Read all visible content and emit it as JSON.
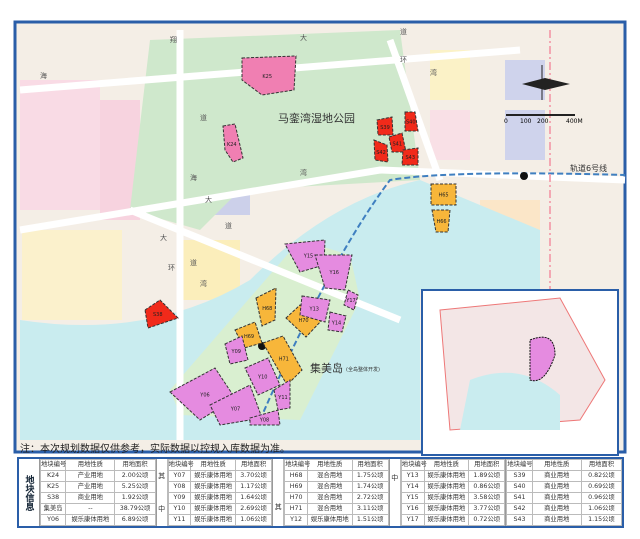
{
  "map": {
    "park_label": "马銮湾湿地公园",
    "island_label": "集美岛",
    "island_sublabel": "(全岛整体开发)",
    "metro_label": "轨道6号线",
    "road_chars": [
      "海",
      "翔",
      "大",
      "道",
      "环",
      "湾",
      "道",
      "海",
      "湾",
      "大",
      "道",
      "大",
      "道",
      "环",
      "湾"
    ],
    "scale": {
      "ticks": [
        "0",
        "100",
        "200",
        "400M"
      ]
    },
    "compass_icon": "north-arrow",
    "colors": {
      "park": "#cfe8cc",
      "water": "#c9ecef",
      "entertainment": "#e58be0",
      "mixed": "#f7b63a",
      "commercial": "#f12a1a",
      "industrial": "#f07fb2",
      "border": "#2a5ea8",
      "metro": "#3f7fc0"
    },
    "parcels": [
      {
        "id": "K25",
        "type": "industrial"
      },
      {
        "id": "K24",
        "type": "industrial"
      },
      {
        "id": "S38",
        "type": "commercial"
      },
      {
        "id": "S39",
        "type": "commercial"
      },
      {
        "id": "S40",
        "type": "commercial"
      },
      {
        "id": "S41",
        "type": "commercial"
      },
      {
        "id": "S42",
        "type": "commercial"
      },
      {
        "id": "S43",
        "type": "commercial"
      },
      {
        "id": "H65",
        "type": "mixed"
      },
      {
        "id": "H66",
        "type": "mixed"
      },
      {
        "id": "H68",
        "type": "mixed"
      },
      {
        "id": "H69",
        "type": "mixed"
      },
      {
        "id": "H70",
        "type": "mixed"
      },
      {
        "id": "H71",
        "type": "mixed"
      },
      {
        "id": "Y15",
        "type": "entertainment"
      },
      {
        "id": "Y16",
        "type": "entertainment"
      },
      {
        "id": "Y17",
        "type": "entertainment"
      },
      {
        "id": "Y13",
        "type": "entertainment"
      },
      {
        "id": "Y14",
        "type": "entertainment"
      },
      {
        "id": "Y09",
        "type": "entertainment"
      },
      {
        "id": "Y06",
        "type": "entertainment"
      },
      {
        "id": "Y10",
        "type": "entertainment"
      },
      {
        "id": "Y07",
        "type": "entertainment"
      },
      {
        "id": "Y11",
        "type": "entertainment"
      },
      {
        "id": "Y08",
        "type": "entertainment"
      }
    ]
  },
  "note": "注：本次规划数据仅供参考，实际数据以控规入库数据为准。",
  "table": {
    "side_label": "地块信息",
    "headers": [
      "地块编号",
      "用地性质",
      "用地面积"
    ],
    "groups": [
      {
        "marker": [],
        "rows": [
          [
            "K24",
            "产业用地",
            "2.00公顷"
          ],
          [
            "K25",
            "产业用地",
            "5.25公顷"
          ],
          [
            "S38",
            "商业用地",
            "1.92公顷"
          ],
          [
            "集美岛",
            "--",
            "38.79公顷"
          ],
          [
            "Y06",
            "娱乐康体用地",
            "6.89公顷"
          ]
        ]
      },
      {
        "marker": [
          "其",
          "中"
        ],
        "rows": [
          [
            "Y07",
            "娱乐康体用地",
            "3.70公顷"
          ],
          [
            "Y08",
            "娱乐康体用地",
            "1.17公顷"
          ],
          [
            "Y09",
            "娱乐康体用地",
            "1.64公顷"
          ],
          [
            "Y10",
            "娱乐康体用地",
            "2.69公顷"
          ],
          [
            "Y11",
            "娱乐康体用地",
            "1.06公顷"
          ]
        ]
      },
      {
        "marker": [
          "",
          "其"
        ],
        "rows": [
          [
            "H68",
            "混合用地",
            "1.75公顷"
          ],
          [
            "H69",
            "混合用地",
            "1.74公顷"
          ],
          [
            "H70",
            "混合用地",
            "2.72公顷"
          ],
          [
            "H71",
            "混合用地",
            "3.11公顷"
          ],
          [
            "Y12",
            "娱乐康体用地",
            "1.51公顷"
          ]
        ]
      },
      {
        "marker": [
          "中",
          ""
        ],
        "rows": [
          [
            "Y13",
            "娱乐康体用地",
            "1.89公顷"
          ],
          [
            "Y14",
            "娱乐康体用地",
            "0.86公顷"
          ],
          [
            "Y15",
            "娱乐康体用地",
            "3.58公顷"
          ],
          [
            "Y16",
            "娱乐康体用地",
            "3.77公顷"
          ],
          [
            "Y17",
            "娱乐康体用地",
            "0.72公顷"
          ]
        ]
      },
      {
        "marker": [],
        "rows": [
          [
            "S39",
            "商业用地",
            "0.82公顷"
          ],
          [
            "S40",
            "商业用地",
            "0.69公顷"
          ],
          [
            "S41",
            "商业用地",
            "0.96公顷"
          ],
          [
            "S42",
            "商业用地",
            "1.06公顷"
          ],
          [
            "S43",
            "商业用地",
            "1.15公顷"
          ]
        ]
      }
    ]
  }
}
